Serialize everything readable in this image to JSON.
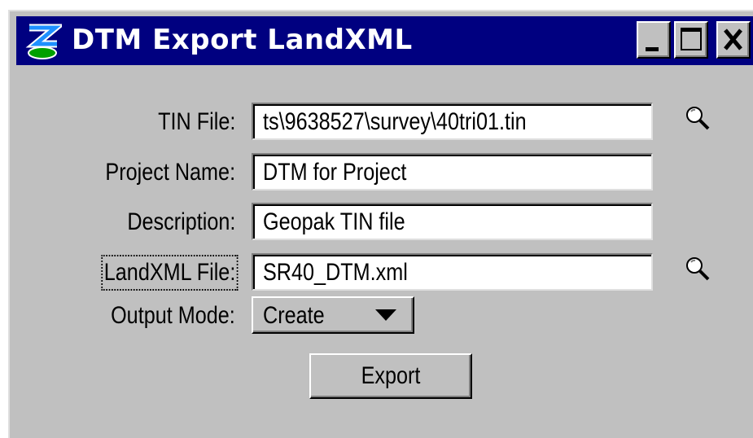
{
  "window": {
    "title": "DTM Export LandXML",
    "icon": "app-logo-icon",
    "controls": [
      "minimize-icon",
      "maximize-icon",
      "close-icon"
    ]
  },
  "form": {
    "tin_file": {
      "label": "TIN File:",
      "value": "ts\\9638527\\survey\\40tri01.tin",
      "browse_icon": "magnifier-icon"
    },
    "project_name": {
      "label": "Project Name:",
      "value": "DTM for Project"
    },
    "description": {
      "label": "Description:",
      "value": "Geopak TIN file"
    },
    "landxml_file": {
      "label": "LandXML File:",
      "value": "SR40_DTM.xml",
      "browse_icon": "magnifier-icon"
    },
    "output_mode": {
      "label": "Output Mode:",
      "value": "Create"
    }
  },
  "actions": {
    "export_label": "Export"
  },
  "colors": {
    "titlebar": "#000080",
    "face": "#c0c0c0",
    "field": "#ffffff",
    "logo_blue": "#1e90ff",
    "logo_green": "#00a000"
  }
}
